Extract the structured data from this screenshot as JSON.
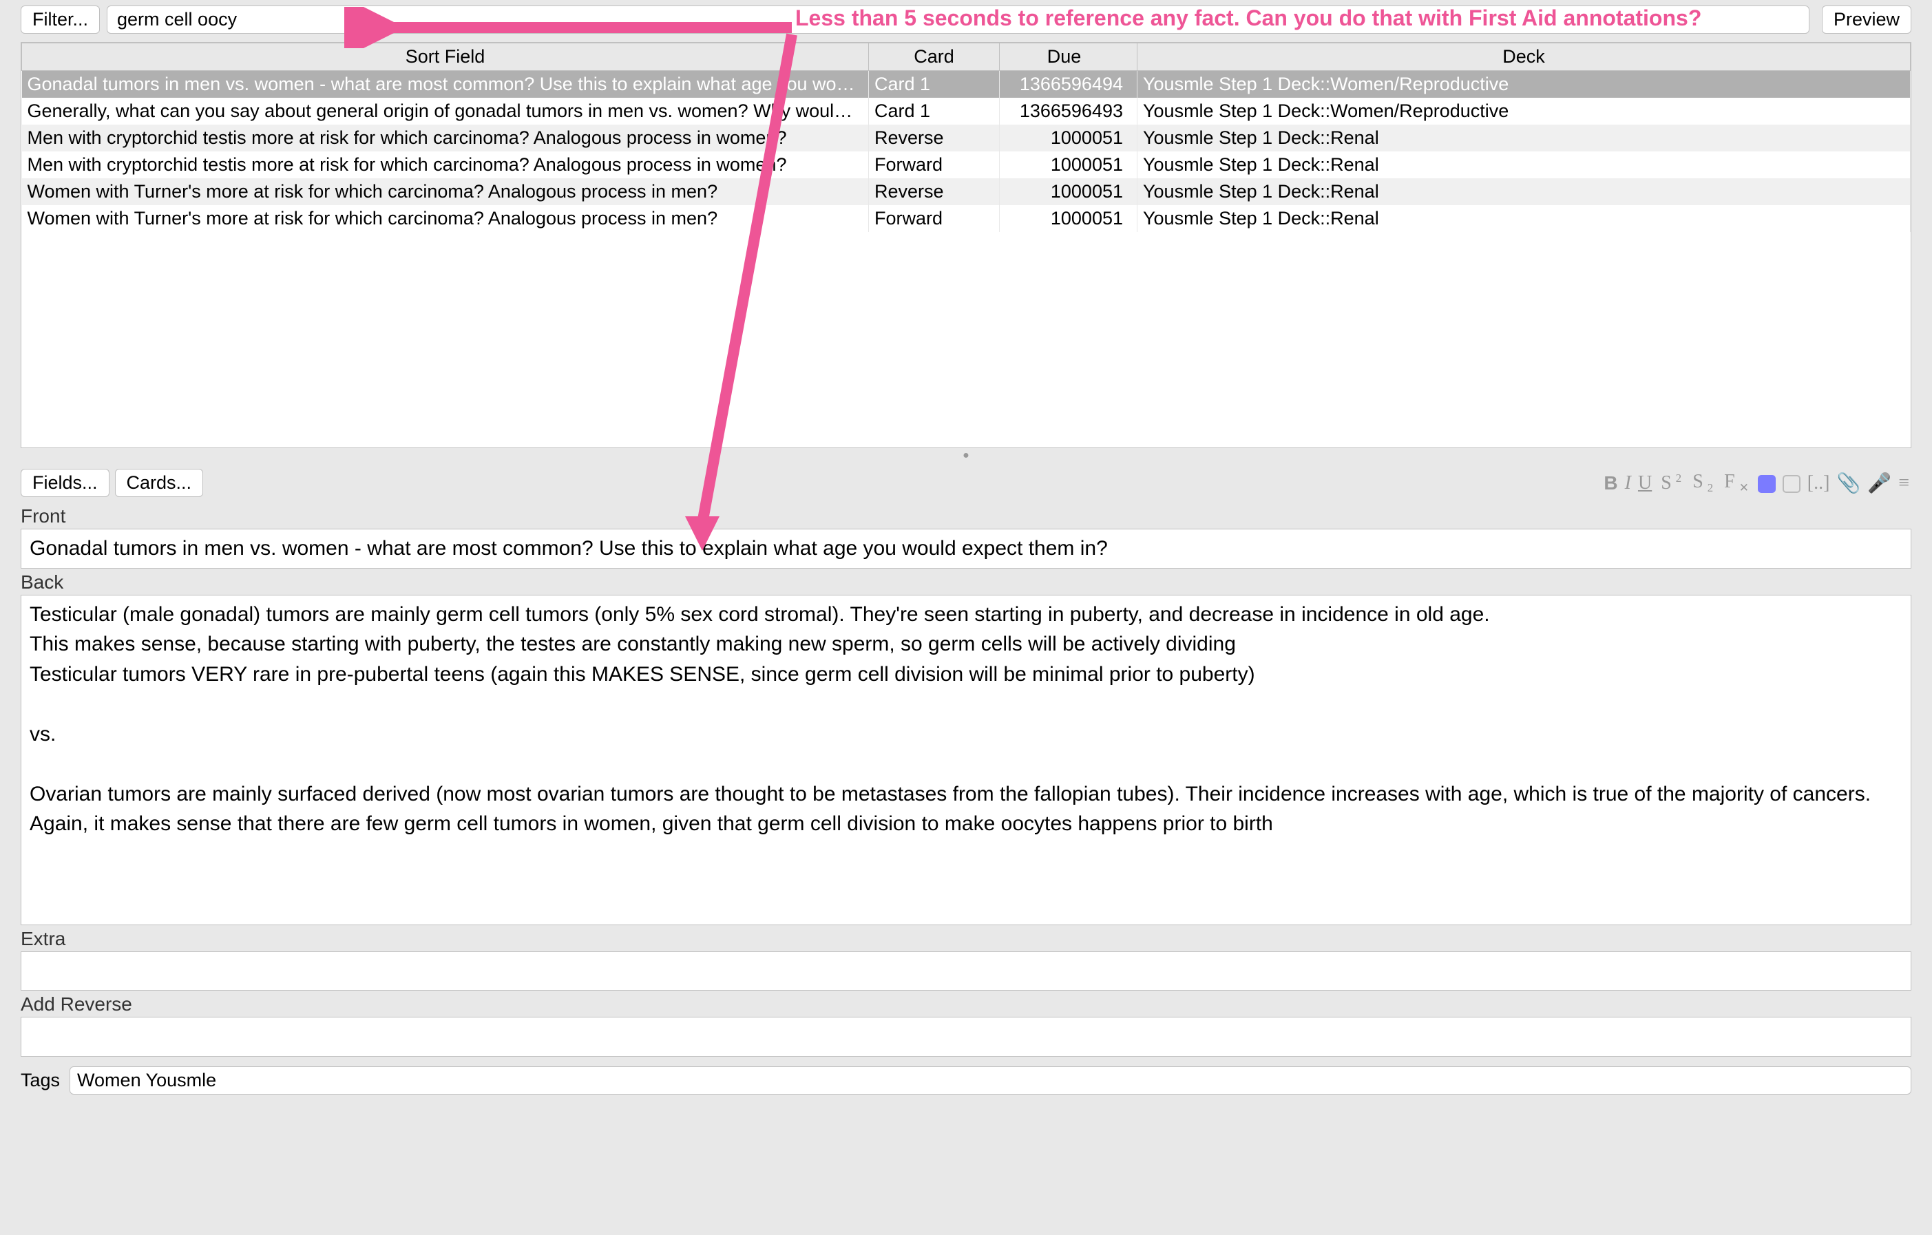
{
  "toolbar": {
    "filter_label": "Filter...",
    "search_value": "germ cell oocy",
    "preview_label": "Preview"
  },
  "annotation_text": "Less than 5 seconds to reference any fact. Can you do that with First Aid annotations?",
  "columns": {
    "sort": "Sort Field",
    "card": "Card",
    "due": "Due",
    "deck": "Deck"
  },
  "rows": [
    {
      "sort": "Gonadal tumors in men vs. women - what are most common? Use this to explain what age you would...",
      "card": "Card 1",
      "due": "1366596494",
      "deck": "Yousmle Step 1 Deck::Women/Reproductive",
      "selected": true
    },
    {
      "sort": "Generally, what can you say about general origin of gonadal tumors in men vs. women? Why would t...",
      "card": "Card 1",
      "due": "1366596493",
      "deck": "Yousmle Step 1 Deck::Women/Reproductive"
    },
    {
      "sort": "Men with cryptorchid testis more at risk for which carcinoma?  Analogous process in women?",
      "card": "Reverse",
      "due": "1000051",
      "deck": "Yousmle Step 1 Deck::Renal",
      "odd": true
    },
    {
      "sort": "Men with cryptorchid testis more at risk for which carcinoma?  Analogous process in women?",
      "card": "Forward",
      "due": "1000051",
      "deck": "Yousmle Step 1 Deck::Renal"
    },
    {
      "sort": "Women with Turner's more at risk for which carcinoma?  Analogous process in men?",
      "card": "Reverse",
      "due": "1000051",
      "deck": "Yousmle Step 1 Deck::Renal",
      "odd": true
    },
    {
      "sort": "Women with Turner's more at risk for which carcinoma?  Analogous process in men?",
      "card": "Forward",
      "due": "1000051",
      "deck": "Yousmle Step 1 Deck::Renal"
    }
  ],
  "editor": {
    "fields_label": "Fields...",
    "cards_label": "Cards...",
    "front_label": "Front",
    "front_value": "Gonadal tumors in men vs. women - what are most common? Use this to explain what age you would expect them in?",
    "back_label": "Back",
    "back_value": "Testicular (male gonadal) tumors are mainly germ cell tumors (only 5% sex cord stromal). They're seen starting in puberty, and decrease in incidence in old age.\nThis makes sense, because starting with puberty, the testes are constantly making new sperm, so germ cells will be actively dividing\nTesticular tumors VERY rare in pre-pubertal teens (again this MAKES SENSE, since germ cell division will be minimal prior to puberty)\n\nvs.\n\nOvarian tumors are mainly surfaced derived (now most ovarian tumors are thought to be metastases from the fallopian tubes). Their incidence increases with age, which is true of the majority of cancers.\nAgain, it makes sense that there are few germ cell tumors in women, given that germ cell division to make oocytes happens prior to birth",
    "extra_label": "Extra",
    "extra_value": "",
    "reverse_label": "Add Reverse",
    "reverse_value": "",
    "tags_label": "Tags",
    "tags_value": "Women Yousmle"
  },
  "icons": {
    "bold": "B",
    "italic": "I",
    "underline": "U",
    "super": "S",
    "sub": "S",
    "clear": "F",
    "cloze": "[..]",
    "attach": "📎",
    "mic": "🎤",
    "menu": "≡"
  }
}
